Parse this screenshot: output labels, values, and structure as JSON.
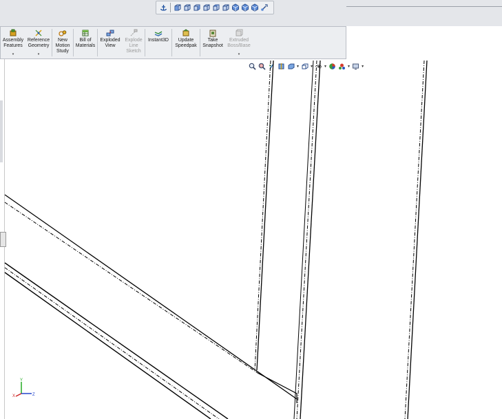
{
  "command_manager": {
    "buttons": [
      {
        "id": "assembly-features",
        "label": "Assembly\nFeatures",
        "icon": "assembly-features-icon",
        "enabled": true,
        "has_dropdown": true
      },
      {
        "id": "reference-geometry",
        "label": "Reference\nGeometry",
        "icon": "reference-geometry-icon",
        "enabled": true,
        "has_dropdown": true
      },
      {
        "id": "new-motion-study",
        "label": "New\nMotion\nStudy",
        "icon": "motion-study-icon",
        "enabled": true,
        "has_dropdown": false
      },
      {
        "id": "bill-of-materials",
        "label": "Bill of\nMaterials",
        "icon": "bill-of-materials-icon",
        "enabled": true,
        "has_dropdown": false
      },
      {
        "id": "exploded-view",
        "label": "Exploded\nView",
        "icon": "exploded-view-icon",
        "enabled": true,
        "has_dropdown": false
      },
      {
        "id": "explode-line-sketch",
        "label": "Explode\nLine\nSketch",
        "icon": "explode-line-sketch-icon",
        "enabled": false,
        "has_dropdown": false
      },
      {
        "id": "instant3d",
        "label": "Instant3D",
        "icon": "instant3d-icon",
        "enabled": true,
        "has_dropdown": false
      },
      {
        "id": "update-speedpak",
        "label": "Update\nSpeedpak",
        "icon": "speedpak-icon",
        "enabled": true,
        "has_dropdown": false
      },
      {
        "id": "take-snapshot",
        "label": "Take\nSnapshot",
        "icon": "snapshot-icon",
        "enabled": true,
        "has_dropdown": false
      },
      {
        "id": "extruded-boss-base",
        "label": "Extruded\nBoss/Base",
        "icon": "extruded-boss-icon",
        "enabled": false,
        "has_dropdown": true
      }
    ],
    "dropdown_glyph": "▾"
  },
  "standard_views": {
    "icons": [
      "anchor-icon",
      "front-view-icon",
      "back-view-icon",
      "left-view-icon",
      "right-view-icon",
      "top-view-icon",
      "bottom-view-icon",
      "isometric-view-icon",
      "trimetric-view-icon",
      "dimetric-view-icon",
      "normal-to-icon"
    ]
  },
  "heads_up_toolbar": {
    "icons": [
      "zoom-to-fit-icon",
      "zoom-to-area-icon",
      "previous-view-icon",
      "section-view-icon",
      "view-orientation-icon",
      "display-style-icon",
      "hide-show-items-icon",
      "edit-appearance-icon",
      "apply-scene-icon",
      "view-settings-icon"
    ],
    "dropdown_glyph": "▾"
  },
  "triad": {
    "x_label": "X",
    "y_label": "Y",
    "z_label": "Z"
  },
  "colors": {
    "toolbar_bg": "#eceef1",
    "canvas_bg": "#ffffff",
    "edge_line": "#000000",
    "triad_x": "#cc2222",
    "triad_y": "#22aa22",
    "triad_z": "#2244cc"
  }
}
